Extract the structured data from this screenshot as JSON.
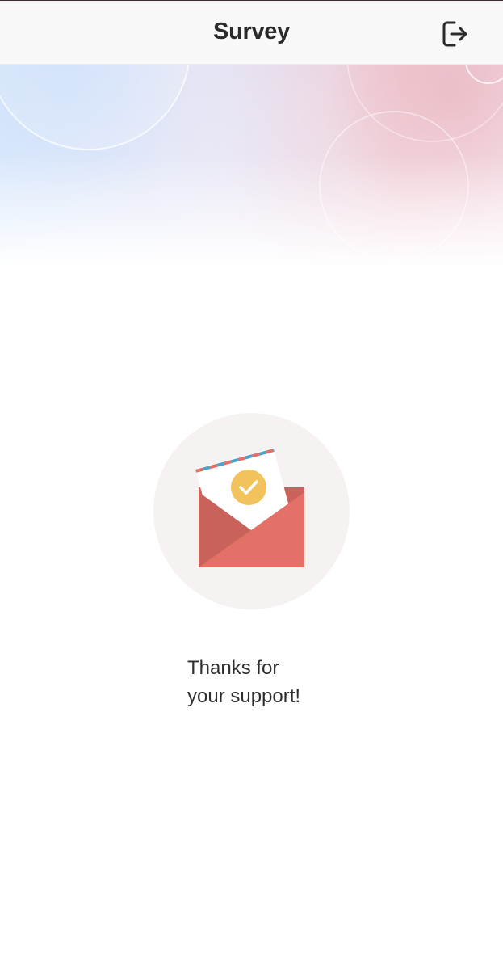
{
  "header": {
    "title": "Survey",
    "logout_icon": "logout-icon"
  },
  "illustration": {
    "icon": "envelope-check-icon",
    "colors": {
      "circle_bg": "#f6f2f2",
      "envelope": "#e37168",
      "envelope_dark": "#c9625b",
      "check_circle": "#f2c25c",
      "stripe_red": "#e07068",
      "stripe_blue": "#4ba3c7"
    }
  },
  "message": {
    "line1": "Thanks for",
    "line2": "your support!"
  }
}
